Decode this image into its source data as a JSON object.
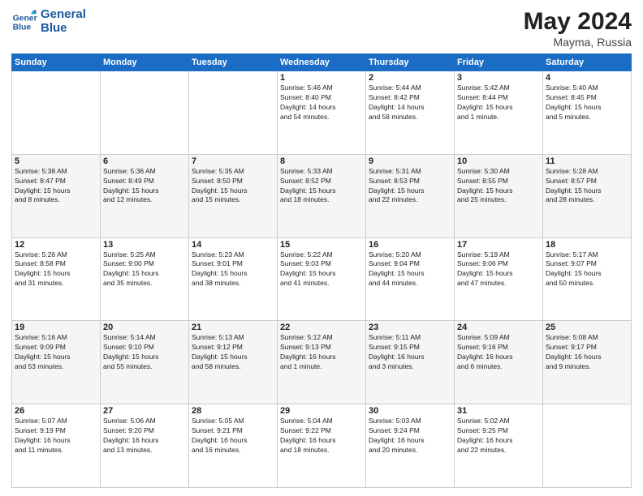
{
  "header": {
    "logo_line1": "General",
    "logo_line2": "Blue",
    "title": "May 2024",
    "location": "Mayma, Russia"
  },
  "days_of_week": [
    "Sunday",
    "Monday",
    "Tuesday",
    "Wednesday",
    "Thursday",
    "Friday",
    "Saturday"
  ],
  "weeks": [
    [
      {
        "day": "",
        "info": ""
      },
      {
        "day": "",
        "info": ""
      },
      {
        "day": "",
        "info": ""
      },
      {
        "day": "1",
        "info": "Sunrise: 5:46 AM\nSunset: 8:40 PM\nDaylight: 14 hours\nand 54 minutes."
      },
      {
        "day": "2",
        "info": "Sunrise: 5:44 AM\nSunset: 8:42 PM\nDaylight: 14 hours\nand 58 minutes."
      },
      {
        "day": "3",
        "info": "Sunrise: 5:42 AM\nSunset: 8:44 PM\nDaylight: 15 hours\nand 1 minute."
      },
      {
        "day": "4",
        "info": "Sunrise: 5:40 AM\nSunset: 8:45 PM\nDaylight: 15 hours\nand 5 minutes."
      }
    ],
    [
      {
        "day": "5",
        "info": "Sunrise: 5:38 AM\nSunset: 8:47 PM\nDaylight: 15 hours\nand 8 minutes."
      },
      {
        "day": "6",
        "info": "Sunrise: 5:36 AM\nSunset: 8:49 PM\nDaylight: 15 hours\nand 12 minutes."
      },
      {
        "day": "7",
        "info": "Sunrise: 5:35 AM\nSunset: 8:50 PM\nDaylight: 15 hours\nand 15 minutes."
      },
      {
        "day": "8",
        "info": "Sunrise: 5:33 AM\nSunset: 8:52 PM\nDaylight: 15 hours\nand 18 minutes."
      },
      {
        "day": "9",
        "info": "Sunrise: 5:31 AM\nSunset: 8:53 PM\nDaylight: 15 hours\nand 22 minutes."
      },
      {
        "day": "10",
        "info": "Sunrise: 5:30 AM\nSunset: 8:55 PM\nDaylight: 15 hours\nand 25 minutes."
      },
      {
        "day": "11",
        "info": "Sunrise: 5:28 AM\nSunset: 8:57 PM\nDaylight: 15 hours\nand 28 minutes."
      }
    ],
    [
      {
        "day": "12",
        "info": "Sunrise: 5:26 AM\nSunset: 8:58 PM\nDaylight: 15 hours\nand 31 minutes."
      },
      {
        "day": "13",
        "info": "Sunrise: 5:25 AM\nSunset: 9:00 PM\nDaylight: 15 hours\nand 35 minutes."
      },
      {
        "day": "14",
        "info": "Sunrise: 5:23 AM\nSunset: 9:01 PM\nDaylight: 15 hours\nand 38 minutes."
      },
      {
        "day": "15",
        "info": "Sunrise: 5:22 AM\nSunset: 9:03 PM\nDaylight: 15 hours\nand 41 minutes."
      },
      {
        "day": "16",
        "info": "Sunrise: 5:20 AM\nSunset: 9:04 PM\nDaylight: 15 hours\nand 44 minutes."
      },
      {
        "day": "17",
        "info": "Sunrise: 5:19 AM\nSunset: 9:06 PM\nDaylight: 15 hours\nand 47 minutes."
      },
      {
        "day": "18",
        "info": "Sunrise: 5:17 AM\nSunset: 9:07 PM\nDaylight: 15 hours\nand 50 minutes."
      }
    ],
    [
      {
        "day": "19",
        "info": "Sunrise: 5:16 AM\nSunset: 9:09 PM\nDaylight: 15 hours\nand 53 minutes."
      },
      {
        "day": "20",
        "info": "Sunrise: 5:14 AM\nSunset: 9:10 PM\nDaylight: 15 hours\nand 55 minutes."
      },
      {
        "day": "21",
        "info": "Sunrise: 5:13 AM\nSunset: 9:12 PM\nDaylight: 15 hours\nand 58 minutes."
      },
      {
        "day": "22",
        "info": "Sunrise: 5:12 AM\nSunset: 9:13 PM\nDaylight: 16 hours\nand 1 minute."
      },
      {
        "day": "23",
        "info": "Sunrise: 5:11 AM\nSunset: 9:15 PM\nDaylight: 16 hours\nand 3 minutes."
      },
      {
        "day": "24",
        "info": "Sunrise: 5:09 AM\nSunset: 9:16 PM\nDaylight: 16 hours\nand 6 minutes."
      },
      {
        "day": "25",
        "info": "Sunrise: 5:08 AM\nSunset: 9:17 PM\nDaylight: 16 hours\nand 9 minutes."
      }
    ],
    [
      {
        "day": "26",
        "info": "Sunrise: 5:07 AM\nSunset: 9:19 PM\nDaylight: 16 hours\nand 11 minutes."
      },
      {
        "day": "27",
        "info": "Sunrise: 5:06 AM\nSunset: 9:20 PM\nDaylight: 16 hours\nand 13 minutes."
      },
      {
        "day": "28",
        "info": "Sunrise: 5:05 AM\nSunset: 9:21 PM\nDaylight: 16 hours\nand 16 minutes."
      },
      {
        "day": "29",
        "info": "Sunrise: 5:04 AM\nSunset: 9:22 PM\nDaylight: 16 hours\nand 18 minutes."
      },
      {
        "day": "30",
        "info": "Sunrise: 5:03 AM\nSunset: 9:24 PM\nDaylight: 16 hours\nand 20 minutes."
      },
      {
        "day": "31",
        "info": "Sunrise: 5:02 AM\nSunset: 9:25 PM\nDaylight: 16 hours\nand 22 minutes."
      },
      {
        "day": "",
        "info": ""
      }
    ]
  ]
}
